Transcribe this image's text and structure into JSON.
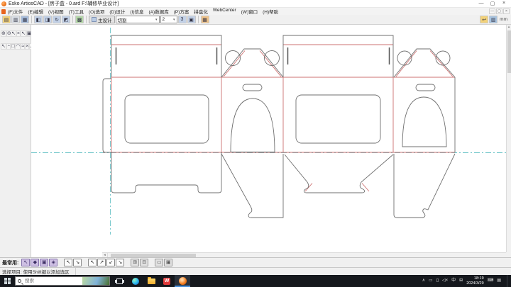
{
  "window": {
    "title": "Esko ArtiosCAD - [房子盒 - 0.ard F:\\辅修毕业设计]",
    "minimize": "—",
    "maximize": "▢",
    "close": "×"
  },
  "child_window": {
    "minimize": "—",
    "restore": "▢",
    "close": "×"
  },
  "menu": {
    "items": [
      "(F)文件",
      "(E)编辑",
      "(V)视图",
      "(T)工具",
      "(O)选项",
      "(D)设计",
      "(I)信息",
      "(A)数据库",
      "(P)方案",
      "拼盘化",
      "WebCenter",
      "(W)窗口",
      "(H)帮助"
    ]
  },
  "toolbar": {
    "left_icons": [
      {
        "name": "open-icon",
        "glyph": "▤",
        "bg": "#f3d27a"
      },
      {
        "name": "print-icon",
        "glyph": "▥",
        "bg": "#d9dee5"
      },
      {
        "name": "save-icon",
        "glyph": "▦",
        "bg": "#a8bedd"
      },
      {
        "sep": true
      },
      {
        "name": "report-icon",
        "glyph": "◧",
        "bg": "#c3d2e8"
      },
      {
        "name": "export-icon",
        "glyph": "◨",
        "bg": "#c3d2e8"
      },
      {
        "name": "rebuild-icon",
        "glyph": "↻",
        "bg": "#c3d2e8"
      },
      {
        "name": "dimension-icon",
        "glyph": "◩",
        "bg": "#c3d2e8"
      },
      {
        "sep": true
      },
      {
        "name": "layers-icon",
        "glyph": "▩",
        "bg": "#b5d9a8"
      },
      {
        "sep": true
      }
    ],
    "main_design_label": "主设计",
    "linetype_value": "切割",
    "pointsize_value": "2",
    "dropdown_arrow": "▾",
    "mid_icons": [
      {
        "name": "pointsize-icon",
        "glyph": "3",
        "bg": "#c3d2e8"
      },
      {
        "name": "linestyle-icon",
        "glyph": "▣",
        "bg": "#c3d2e8"
      },
      {
        "sep": true
      },
      {
        "name": "grid-icon",
        "glyph": "▦",
        "bg": "#f0c48a"
      }
    ],
    "right_icons": [
      {
        "name": "undo-icon",
        "glyph": "↩",
        "bg": "#f3d27a"
      },
      {
        "name": "workspace-icon",
        "glyph": "▥",
        "bg": "#a8c4e0"
      }
    ],
    "units_label": "mm"
  },
  "palettes": {
    "columns": [
      {
        "name": "view-tools",
        "x": 1,
        "icons": [
          "⊕",
          "⊖",
          "▭",
          "◎",
          "↻",
          "▣",
          "/",
          "↖",
          "◔",
          "□",
          "◠",
          "≈",
          "×",
          "∠",
          "▫",
          "△",
          "▭",
          "~",
          "∫"
        ]
      },
      {
        "name": "zoom-tools",
        "x": 15,
        "icons": [
          "↖",
          "×",
          "+",
          "◎",
          "∠",
          "\\",
          "▦",
          "⊞",
          "T",
          "∥",
          "≡",
          "↕",
          "▪"
        ]
      },
      {
        "name": "design-tools",
        "x": 29,
        "icons": [
          "↖",
          "▣",
          "⊡",
          "T",
          "J",
          "▩",
          "◇",
          "▤",
          "↺",
          "◠",
          "△",
          "▥",
          "↗",
          "⇄",
          "⊞",
          "◆",
          "≈",
          "i",
          "↓",
          "◈",
          "⊟",
          "▫",
          "⊕"
        ]
      }
    ]
  },
  "quickbar": {
    "label": "最常用:",
    "groups": [
      {
        "style": "q-purple",
        "name": "select-tools",
        "icons": [
          "↖",
          "◆",
          "▣",
          "◈"
        ]
      },
      {
        "style": "q-plain",
        "name": "move-tools",
        "icons": [
          "↖",
          "↘"
        ]
      },
      {
        "style": "q-plain",
        "name": "copy-tools",
        "icons": [
          "↖",
          "↗",
          "↙",
          "↘"
        ]
      },
      {
        "style": "q-gray",
        "name": "snap-tools",
        "icons": [
          "⊞",
          "⊟"
        ]
      },
      {
        "style": "q-gray",
        "name": "view-toggles",
        "icons": [
          "▭",
          "▣"
        ]
      }
    ]
  },
  "statusbar": {
    "message": "选择项目: 使用Shift键以添加选区"
  },
  "scrollbar": {
    "left_arrow": "◂",
    "up_arrow": "▴",
    "down_arrow": "▾"
  },
  "taskbar": {
    "search_placeholder": "搜索",
    "wps_label": "W",
    "tray_icons": [
      {
        "name": "chevron-up-icon",
        "glyph": "∧"
      },
      {
        "name": "display-icon",
        "glyph": "▭"
      },
      {
        "name": "battery-icon",
        "glyph": "▯"
      },
      {
        "name": "volume-muted-icon",
        "glyph": "◁×"
      },
      {
        "name": "ime-chinese-indicator",
        "glyph": "中"
      },
      {
        "name": "ime-mode-icon",
        "glyph": "⊞"
      }
    ],
    "time": "18:19",
    "date": "2024/3/29",
    "tray_icons_after_clock": [
      {
        "name": "touch-keyboard-icon",
        "glyph": "⌨"
      },
      {
        "name": "notification-icon",
        "glyph": "▤"
      }
    ]
  },
  "colors": {
    "cut": "#6f6f6f",
    "crease": "#cd7171",
    "guide": "#6cc4c8",
    "taskbar_bg": "#15181d"
  }
}
